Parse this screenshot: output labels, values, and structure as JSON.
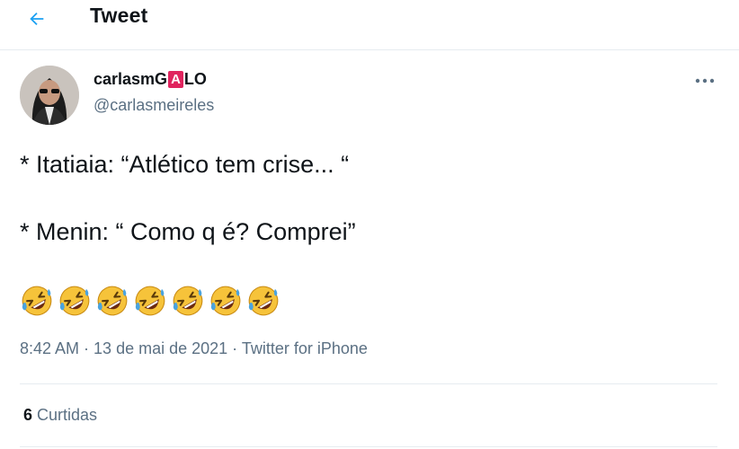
{
  "header": {
    "back_icon": "arrow-left-icon",
    "title": "Tweet",
    "accent_color": "#1da1f2"
  },
  "author": {
    "name_prefix": "carlasmG",
    "name_highlight": "A",
    "name_suffix": "LO",
    "handle": "@carlasmeireles",
    "more_icon": "more-horizontal-icon"
  },
  "tweet": {
    "line1": "* Itatiaia: “Atlético tem crise... “",
    "line2": "* Menin: “ Como q é? Comprei”",
    "emojis": [
      "rolling-on-floor-laughing-emoji",
      "rolling-on-floor-laughing-emoji",
      "rolling-on-floor-laughing-emoji",
      "rolling-on-floor-laughing-emoji",
      "rolling-on-floor-laughing-emoji",
      "rolling-on-floor-laughing-emoji",
      "rolling-on-floor-laughing-emoji"
    ]
  },
  "meta": {
    "time": "8:42 AM",
    "separator": " · ",
    "date": "13 de mai de 2021",
    "source": "Twitter for iPhone"
  },
  "stats": {
    "likes_count": "6",
    "likes_label": " Curtidas"
  }
}
